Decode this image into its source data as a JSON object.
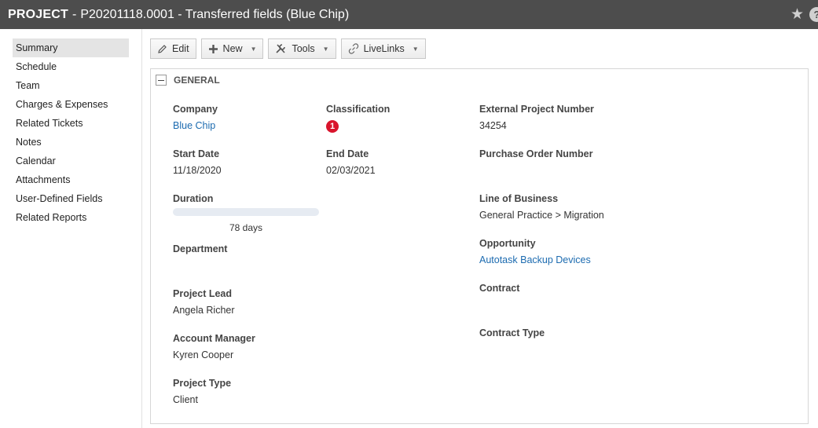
{
  "title": {
    "kind": "PROJECT",
    "separator": "-",
    "name": "P20201118.0001 - Transferred fields (Blue Chip)",
    "star_icon": "star-icon",
    "help_icon": "help-icon"
  },
  "sidebar": {
    "items": [
      {
        "label": "Summary",
        "active": true
      },
      {
        "label": "Schedule"
      },
      {
        "label": "Team"
      },
      {
        "label": "Charges & Expenses"
      },
      {
        "label": "Related Tickets"
      },
      {
        "label": "Notes"
      },
      {
        "label": "Calendar"
      },
      {
        "label": "Attachments"
      },
      {
        "label": "User-Defined Fields"
      },
      {
        "label": "Related Reports"
      }
    ]
  },
  "toolbar": {
    "edit_label": "Edit",
    "new_label": "New",
    "tools_label": "Tools",
    "livelinks_label": "LiveLinks"
  },
  "general": {
    "heading": "GENERAL",
    "company": {
      "label": "Company",
      "value": "Blue Chip"
    },
    "classification": {
      "label": "Classification",
      "badge": "1",
      "badge_color": "#d9142c"
    },
    "external_project_number": {
      "label": "External Project Number",
      "value": "34254"
    },
    "start_date": {
      "label": "Start Date",
      "value": "11/18/2020"
    },
    "end_date": {
      "label": "End Date",
      "value": "02/03/2021"
    },
    "purchase_order_number": {
      "label": "Purchase Order Number",
      "value": ""
    },
    "duration": {
      "label": "Duration",
      "value": "78 days",
      "progress": 0
    },
    "line_of_business": {
      "label": "Line of Business",
      "value": "General Practice > Migration"
    },
    "department": {
      "label": "Department",
      "value": ""
    },
    "opportunity": {
      "label": "Opportunity",
      "value": "Autotask Backup Devices"
    },
    "project_lead": {
      "label": "Project Lead",
      "value": "Angela Richer"
    },
    "contract": {
      "label": "Contract",
      "value": ""
    },
    "account_manager": {
      "label": "Account Manager",
      "value": "Kyren Cooper"
    },
    "contract_type": {
      "label": "Contract Type",
      "value": ""
    },
    "project_type": {
      "label": "Project Type",
      "value": "Client"
    }
  },
  "colors": {
    "titlebar": "#4d4d4d",
    "link": "#1c6bb0",
    "badge": "#d9142c"
  }
}
